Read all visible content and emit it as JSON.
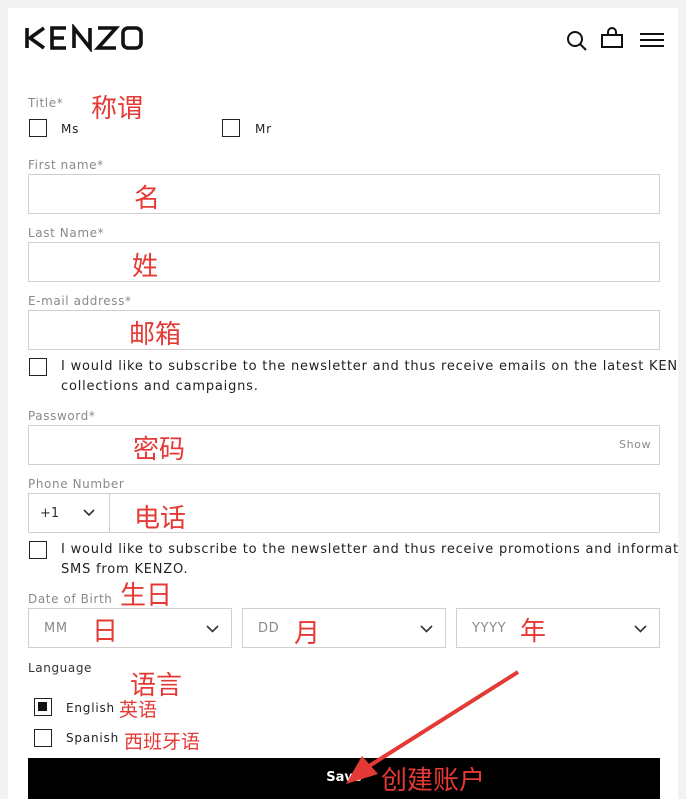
{
  "header": {
    "brand": "KENZO",
    "icons": [
      "search-icon",
      "bag-icon",
      "menu-icon"
    ]
  },
  "form": {
    "title_label": "Title*",
    "title_ms": "Ms",
    "title_mr": "Mr",
    "first_name_label": "First name*",
    "last_name_label": "Last Name*",
    "email_label": "E-mail address*",
    "newsletter_email_line1": "I would like to subscribe to the newsletter and thus receive emails on the latest KENZO",
    "newsletter_email_line2": "collections and campaigns.",
    "password_label": "Password*",
    "password_show": "Show",
    "phone_label": "Phone Number",
    "phone_code": "+1",
    "newsletter_sms_line1": "I would like to subscribe to the newsletter and thus receive promotions and information",
    "newsletter_sms_line2": "SMS from KENZO.",
    "dob_label": "Date of Birth",
    "dob_mm": "MM",
    "dob_dd": "DD",
    "dob_yyyy": "YYYY",
    "language_label": "Language",
    "language_english": "English",
    "language_spanish": "Spanish",
    "language_selected": "English",
    "save_label": "Save"
  },
  "annotations": {
    "title": "称谓",
    "first_name": "名",
    "last_name": "姓",
    "email": "邮箱",
    "password": "密码",
    "phone": "电话",
    "dob": "生日",
    "day": "日",
    "month": "月",
    "year": "年",
    "language": "语言",
    "english": "英语",
    "spanish": "西班牙语",
    "save": "创建账户"
  },
  "colors": {
    "annotation": "#e53935",
    "button_bg": "#000000",
    "field_border": "#cfcfcf",
    "label_grey": "#8a8a8a"
  }
}
